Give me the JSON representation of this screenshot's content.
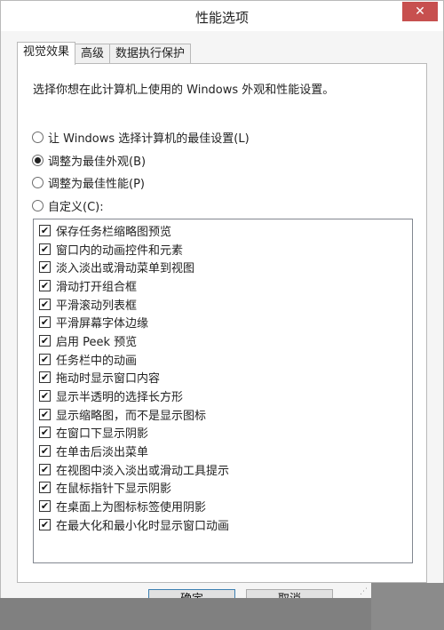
{
  "window": {
    "title": "性能选项",
    "close_label": "✕"
  },
  "tabs": [
    {
      "label": "视觉效果",
      "active": true
    },
    {
      "label": "高级",
      "active": false
    },
    {
      "label": "数据执行保护",
      "active": false
    }
  ],
  "visual_effects": {
    "description": "选择你想在此计算机上使用的 Windows 外观和性能设置。",
    "options": [
      {
        "label": "让 Windows 选择计算机的最佳设置(L)",
        "checked": false
      },
      {
        "label": "调整为最佳外观(B)",
        "checked": true
      },
      {
        "label": "调整为最佳性能(P)",
        "checked": false
      },
      {
        "label": "自定义(C):",
        "checked": false
      }
    ],
    "effects": [
      {
        "label": "保存任务栏缩略图预览",
        "checked": true
      },
      {
        "label": "窗口内的动画控件和元素",
        "checked": true
      },
      {
        "label": "淡入淡出或滑动菜单到视图",
        "checked": true
      },
      {
        "label": "滑动打开组合框",
        "checked": true
      },
      {
        "label": "平滑滚动列表框",
        "checked": true
      },
      {
        "label": "平滑屏幕字体边缘",
        "checked": true
      },
      {
        "label": "启用 Peek 预览",
        "checked": true
      },
      {
        "label": "任务栏中的动画",
        "checked": true
      },
      {
        "label": "拖动时显示窗口内容",
        "checked": true
      },
      {
        "label": "显示半透明的选择长方形",
        "checked": true
      },
      {
        "label": "显示缩略图，而不是显示图标",
        "checked": true
      },
      {
        "label": "在窗口下显示阴影",
        "checked": true
      },
      {
        "label": "在单击后淡出菜单",
        "checked": true
      },
      {
        "label": "在视图中淡入淡出或滑动工具提示",
        "checked": true
      },
      {
        "label": "在鼠标指针下显示阴影",
        "checked": true
      },
      {
        "label": "在桌面上为图标标签使用阴影",
        "checked": true
      },
      {
        "label": "在最大化和最小化时显示窗口动画",
        "checked": true
      }
    ]
  },
  "buttons": {
    "ok_label": "确定",
    "cancel_label": "取消"
  },
  "icons": {
    "checkmark": "✔",
    "grip": "⋰"
  }
}
